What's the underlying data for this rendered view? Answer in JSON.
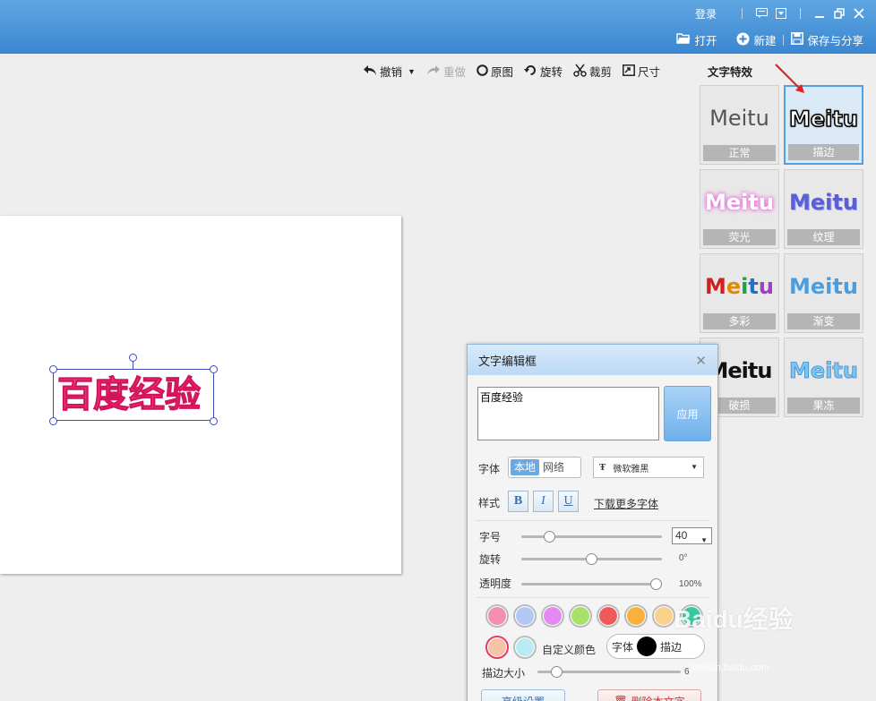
{
  "titlebar": {
    "login": "登录",
    "actions": [
      {
        "icon": "folder-open-icon",
        "label": "打开"
      },
      {
        "icon": "plus-circle-icon",
        "label": "新建"
      },
      {
        "icon": "save-icon",
        "label": "保存与分享"
      }
    ]
  },
  "toolbar": {
    "undo": "撤销",
    "redo": "重做",
    "original": "原图",
    "rotate": "旋转",
    "crop": "裁剪",
    "size": "尺寸"
  },
  "canvas": {
    "text": "百度经验"
  },
  "effects": {
    "title": "文字特效",
    "items": [
      {
        "preview": "Meitu",
        "label": "正常"
      },
      {
        "preview": "Meitu",
        "label": "描边",
        "selected": true
      },
      {
        "preview": "Meitu",
        "label": "荧光"
      },
      {
        "preview": "Meitu",
        "label": "纹理"
      },
      {
        "preview": "Meitu",
        "label": "多彩"
      },
      {
        "preview": "Meitu",
        "label": "渐变"
      },
      {
        "preview": "Meitu",
        "label": "破损"
      },
      {
        "preview": "Meitu",
        "label": "果冻"
      }
    ]
  },
  "dialog": {
    "title": "文字编辑框",
    "text_value": "百度经验",
    "apply": "应用",
    "font_label": "字体",
    "font_source": [
      "本地",
      "网络"
    ],
    "font_name": "微软雅黑",
    "style_label": "样式",
    "bold": "B",
    "italic": "I",
    "underline": "U",
    "more_fonts": "下载更多字体",
    "size_label": "字号",
    "size_value": "40",
    "rotate_label": "旋转",
    "rotate_value": "0°",
    "rotate_level": 0.5,
    "opacity_label": "透明度",
    "opacity_value": "100%",
    "opacity_level": 1.0,
    "colors": [
      "#f48fb1",
      "#b3c7f7",
      "#e58af0",
      "#a8e06a",
      "#f05a5a",
      "#f9b13d",
      "#fbd08a",
      "#38c9a0"
    ],
    "custom_colors": [
      "#f7c3a6",
      "#b8ecf2"
    ],
    "custom_color_label": "自定义颜色",
    "target_font": "字体",
    "target_stroke": "描边",
    "stroke_size_label": "描边大小",
    "stroke_size_value": "6",
    "advanced": "高级设置",
    "delete": "删除本文字"
  },
  "watermark": {
    "brand": "Baidu经验",
    "url": "jingyan.baidu.com"
  }
}
